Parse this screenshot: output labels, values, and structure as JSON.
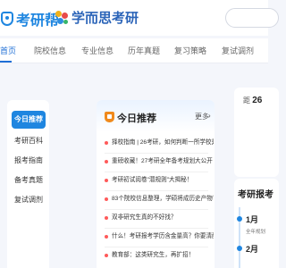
{
  "header": {
    "logo1_text": "考研帮",
    "logo2_text": "学而思考研"
  },
  "nav": {
    "items": [
      "首页",
      "院校信息",
      "专业信息",
      "历年真题",
      "复习策略",
      "复试调剂"
    ]
  },
  "sidebar": {
    "items": [
      "今日推荐",
      "考研百科",
      "报考指南",
      "备考真题",
      "复试调剂"
    ]
  },
  "card": {
    "title": "今日推荐",
    "more": "更多",
    "news": [
      "择校指南 | 26考研，如何判断一所学校是否...",
      "重磅收藏！27考研全年备考规划大公开！",
      "考研初试阅卷\"潜规则\"大揭秘！",
      "83个院校信息整理，学硕将成历史产物？",
      "双非研究生真的不好找？",
      "什么！考研报考学历含金量高？你要清醒一...",
      "教育部：这类研究生，再扩招！"
    ]
  },
  "right": {
    "countdown_prefix": "距",
    "countdown_value": "26",
    "calendar_title": "考研报考",
    "timeline": [
      {
        "month": "1月",
        "desc": "全年规划"
      },
      {
        "month": "2月",
        "desc": ""
      }
    ]
  },
  "colors": {
    "brand_blue": "#1f86e0",
    "nav_active": "#1f6fd6",
    "accent_orange": "#f08a1c",
    "news_dot": "#ff5a5a"
  }
}
